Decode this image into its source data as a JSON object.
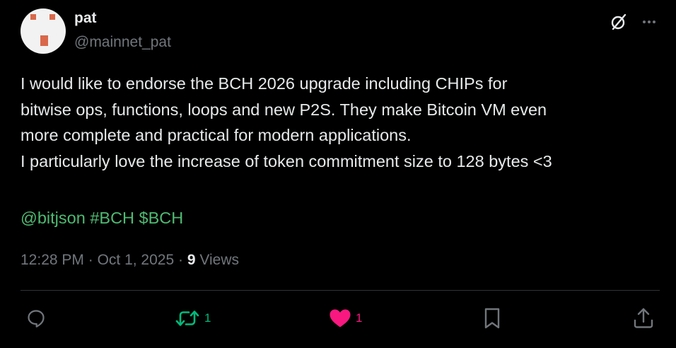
{
  "author": {
    "name": "pat",
    "handle": "@mainnet_pat"
  },
  "tweet": {
    "text": "I would like to endorse the BCH 2026 upgrade including CHIPs for\nbitwise ops, functions, loops and new P2S. They make Bitcoin VM even\nmore complete and practical for modern applications.\nI particularly love the increase of token commitment size to 128 bytes <3",
    "tags": {
      "mention": "@bitjson",
      "hashtag": "#BCH",
      "cashtag": "$BCH"
    }
  },
  "meta": {
    "time": "12:28 PM",
    "sep1": "·",
    "date": "Oct 1, 2025",
    "sep2": "·",
    "views_count": "9",
    "views_label": "Views"
  },
  "actions": {
    "reposts": "1",
    "likes": "1"
  },
  "colors": {
    "background": "#000000",
    "text": "#e7e9ea",
    "secondary": "#71767b",
    "link": "#4fba72",
    "repost": "#00ba7c",
    "like": "#f91880"
  },
  "icons": {
    "grok": "grok-slash-icon",
    "more": "more-dots-icon",
    "reply": "reply-bubble-icon",
    "repost": "repost-arrows-icon",
    "like": "heart-filled-icon",
    "bookmark": "bookmark-icon",
    "share": "share-upload-icon"
  }
}
